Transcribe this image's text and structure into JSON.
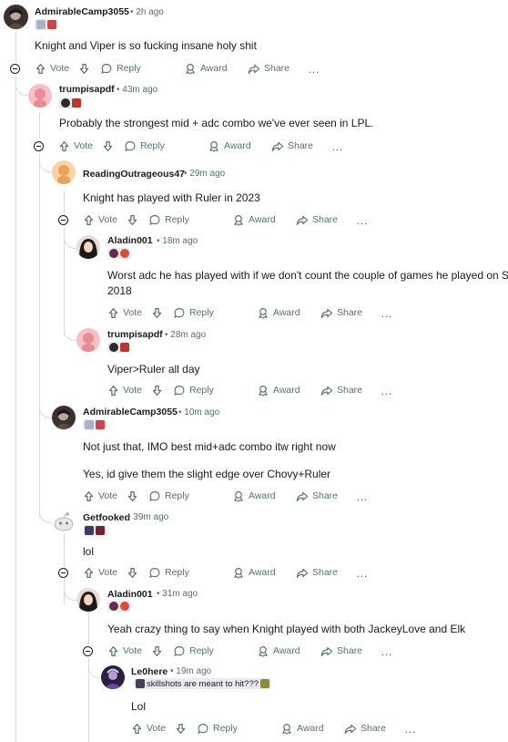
{
  "actions": {
    "vote": "Vote",
    "reply": "Reply",
    "award": "Award",
    "share": "Share",
    "more": "…"
  },
  "colors": {
    "muted_text": "#576f76",
    "thread_line": "#d8dbdf",
    "flair_bg": "#e9ebee"
  },
  "comments": [
    {
      "user": "AdmirableCamp3055",
      "time": "2h ago",
      "flair": [
        "lpl-team-icon",
        "red-team-icon"
      ],
      "avatar": "dark-character-avatar",
      "lines": [
        "Knight and Viper is so fucking insane holy shit"
      ]
    },
    {
      "user": "trumpisapdf",
      "time": "43m ago",
      "flair": [
        "dark-team-icon",
        "red-team-icon"
      ],
      "avatar": "pink-snoo-avatar",
      "lines": [
        "Probably the strongest mid + adc combo we've ever seen in LPL."
      ]
    },
    {
      "user": "ReadingOutrageous47",
      "time": "29m ago",
      "flair": [],
      "avatar": "orange-snoo-avatar",
      "lines": [
        "Knight has played with Ruler in 2023"
      ]
    },
    {
      "user": "Aladin001",
      "time": "18m ago",
      "flair": [
        "purple-team-icon",
        "red-team-icon"
      ],
      "avatar": "photo-avatar",
      "lines": [
        "Worst adc he has played with if we don't count the couple of games he played on Sun",
        "2018"
      ]
    },
    {
      "user": "trumpisapdf",
      "time": "28m ago",
      "flair": [
        "dark-team-icon",
        "red-team-icon"
      ],
      "avatar": "pink-snoo-avatar",
      "lines": [
        "Viper>Ruler all day"
      ]
    },
    {
      "user": "AdmirableCamp3055",
      "time": "10m ago",
      "flair": [
        "lpl-team-icon",
        "red-team-icon"
      ],
      "avatar": "dark-character-avatar",
      "lines": [
        "Not just that, IMO best mid+adc combo itw right now",
        "",
        "Yes, id give them the slight edge over Chovy+Ruler"
      ]
    },
    {
      "user": "Getfooked",
      "time": "39m ago",
      "flair": [
        "champion-icon",
        "champion-icon-2"
      ],
      "avatar": "default-snoo-avatar",
      "lines": [
        "lol"
      ]
    },
    {
      "user": "Aladin001",
      "time": "31m ago",
      "flair": [
        "purple-team-icon",
        "red-team-icon"
      ],
      "avatar": "photo-avatar",
      "lines": [
        "Yeah crazy thing to say when Knight played with both JackeyLove and Elk"
      ]
    },
    {
      "user": "Le0here",
      "time": "19m ago",
      "flair_text": "skillshots are meant to hit???",
      "flair": [
        "champion-portrait-icon",
        "emote-icon"
      ],
      "avatar": "purple-character-avatar",
      "lines": [
        "Lol"
      ]
    }
  ]
}
